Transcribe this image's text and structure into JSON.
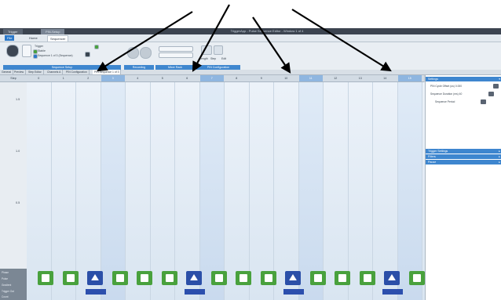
{
  "window": {
    "tabs": [
      "Trigger",
      "PIN-Setup"
    ],
    "title": "TriggerApp - Pulse Sequence Editor - Window 1 of 4"
  },
  "menu": {
    "file_label": "File",
    "items": [
      "Home",
      "Sequencer"
    ]
  },
  "ribbon": {
    "groups": [
      {
        "caption": "Sequence Setup",
        "labels": [
          "Trigger",
          "Stable",
          "Sequence 1 of 3 (Sequence)"
        ]
      },
      {
        "caption": "Recording"
      },
      {
        "caption": "Mixer Rack"
      },
      {
        "caption": "PIN Configuration",
        "labels": [
          "Length",
          "Step",
          "Edit"
        ]
      }
    ]
  },
  "doc_tabs": [
    "General",
    "Preview",
    "Step Editor",
    "Channels A",
    "PIN Configuration",
    "PIN-Sequence 1 of 3"
  ],
  "timeline": {
    "corner_label": "Step",
    "columns": [
      "0",
      "1",
      "2",
      "3",
      "4",
      "5",
      "6",
      "7",
      "8",
      "9",
      "10",
      "11",
      "12",
      "13",
      "14",
      "15",
      "16"
    ],
    "highlighted_columns": [
      3,
      7,
      11,
      15
    ],
    "y_labels": [
      "1.5",
      "1.0",
      "0.5"
    ],
    "slot_types": [
      "green",
      "green",
      "blue",
      "green",
      "green",
      "green",
      "blue",
      "green",
      "green",
      "green",
      "blue",
      "green",
      "green",
      "green",
      "blue",
      "green"
    ],
    "row_labels": [
      "Phase",
      "Pulse",
      "Gradient",
      "Trigger Out",
      "Count"
    ]
  },
  "panel": {
    "settings_title": "Settings",
    "fields": [
      {
        "label": "PIN Cycle Offset (us) 0.000"
      },
      {
        "label": "Sequence Duration (ms) 40"
      },
      {
        "label": "Sequence Period"
      }
    ],
    "sections": [
      "Trigger Settings",
      "Filters",
      "Pause"
    ]
  },
  "colors": {
    "accent_blue": "#3f87cf",
    "slot_green": "#49a13d",
    "slot_blue": "#2b4fa8"
  }
}
